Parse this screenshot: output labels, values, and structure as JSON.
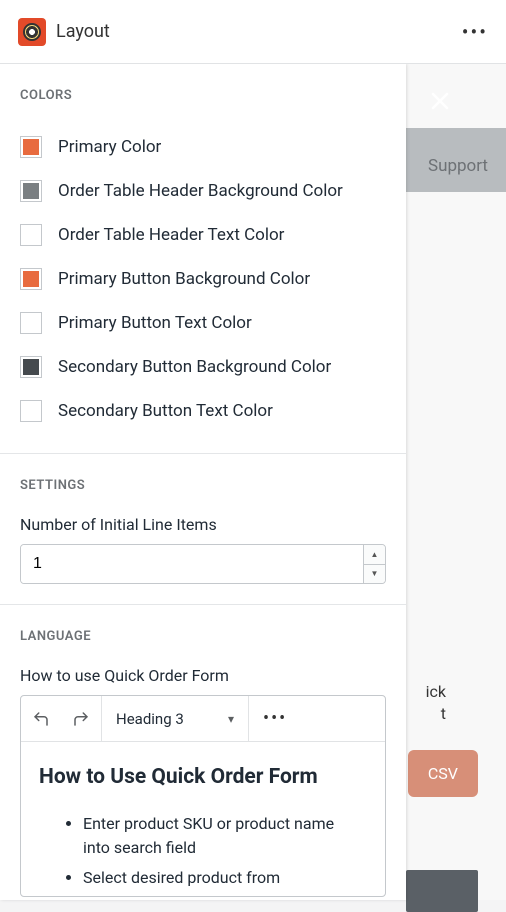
{
  "header": {
    "title": "Layout"
  },
  "background": {
    "support": "Support",
    "hint1": "ick",
    "hint2": "t",
    "csv": "CSV"
  },
  "colors": {
    "title": "COLORS",
    "items": [
      {
        "label": "Primary Color",
        "value": "#e86b3f"
      },
      {
        "label": "Order Table Header Background Color",
        "value": "#7a7f82"
      },
      {
        "label": "Order Table Header Text Color",
        "value": "#ffffff"
      },
      {
        "label": "Primary Button Background Color",
        "value": "#e86b3f"
      },
      {
        "label": "Primary Button Text Color",
        "value": "#ffffff"
      },
      {
        "label": "Secondary Button Background Color",
        "value": "#454a4e"
      },
      {
        "label": "Secondary Button Text Color",
        "value": "#ffffff"
      }
    ]
  },
  "settings": {
    "title": "SETTINGS",
    "lineItemsLabel": "Number of Initial Line Items",
    "lineItemsValue": "1"
  },
  "language": {
    "title": "LANGUAGE",
    "fieldLabel": "How to use Quick Order Form",
    "headingSelect": "Heading 3",
    "content": {
      "heading": "How to Use Quick Order Form",
      "bullets": [
        "Enter product SKU or product name into search field",
        "Select desired product from"
      ]
    }
  }
}
